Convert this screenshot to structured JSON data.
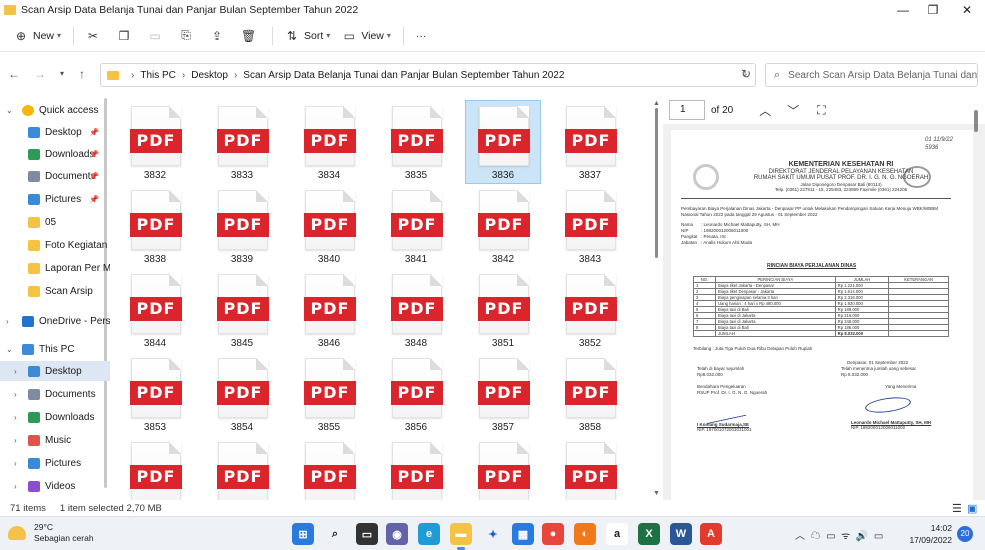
{
  "window": {
    "title": "Scan Arsip Data Belanja Tunai dan Panjar Bulan September Tahun 2022",
    "controls": [
      "—",
      "❐",
      "✕"
    ]
  },
  "commandbar": {
    "new": "New",
    "sort": "Sort",
    "view": "View",
    "more": "···"
  },
  "address": {
    "crumbs": [
      "This PC",
      "Desktop",
      "Scan Arsip Data Belanja Tunai dan Panjar Bulan September Tahun 2022"
    ],
    "search_placeholder": "Search Scan Arsip Data Belanja Tunai dan Pan..."
  },
  "nav": {
    "items": [
      {
        "label": "Quick access",
        "icon": "star-icon",
        "level": 0,
        "expanded": true
      },
      {
        "label": "Desktop",
        "icon": "desktop-icon",
        "level": 1,
        "pinned": true
      },
      {
        "label": "Downloads",
        "icon": "download-icon",
        "level": 1,
        "pinned": true
      },
      {
        "label": "Documents",
        "icon": "documents-icon",
        "level": 1,
        "pinned": true
      },
      {
        "label": "Pictures",
        "icon": "pictures-icon",
        "level": 1,
        "pinned": true
      },
      {
        "label": "05",
        "icon": "folder-icon",
        "level": 1
      },
      {
        "label": "Foto Kegiatan I",
        "icon": "folder-icon",
        "level": 1
      },
      {
        "label": "Laporan Per Mi",
        "icon": "folder-icon",
        "level": 1
      },
      {
        "label": "Scan Arsip",
        "icon": "folder-icon",
        "level": 1
      },
      {
        "label": "OneDrive - Perso",
        "icon": "cloud-icon",
        "level": 0
      },
      {
        "label": "This PC",
        "icon": "pc-icon",
        "level": 0,
        "expanded": true
      },
      {
        "label": "Desktop",
        "icon": "desktop-icon",
        "level": 1,
        "selected": true
      },
      {
        "label": "Documents",
        "icon": "documents-icon",
        "level": 1
      },
      {
        "label": "Downloads",
        "icon": "download-icon",
        "level": 1
      },
      {
        "label": "Music",
        "icon": "music-icon",
        "level": 1
      },
      {
        "label": "Pictures",
        "icon": "pictures-icon",
        "level": 1
      },
      {
        "label": "Videos",
        "icon": "videos-icon",
        "level": 1
      }
    ]
  },
  "files": {
    "badge": "PDF",
    "items": [
      "3832",
      "3833",
      "3834",
      "3835",
      "3836",
      "3837",
      "3838",
      "3839",
      "3840",
      "3841",
      "3842",
      "3843",
      "3844",
      "3845",
      "3846",
      "3848",
      "3851",
      "3852",
      "3853",
      "3854",
      "3855",
      "3856",
      "3857",
      "3858",
      "",
      "",
      "",
      "",
      "",
      ""
    ],
    "selected_index": 4
  },
  "preview": {
    "page": "1",
    "of": "of 20",
    "doc": {
      "stamp": "01 11/9/22\n5936",
      "header": [
        "KEMENTERIAN KESEHATAN RI",
        "DIREKTORAT JENDERAL PELAYANAN KESEHATAN",
        "RUMAH SAKIT UMUM PUSAT PROF. DR. I. G. N. G. NGOERAH",
        "Jalan Diponegoro Denpasar Bali (80114)",
        "Telp. (0361) 227911 - 15, 225483, 223869  Faximile (0361) 224206"
      ],
      "intro": [
        "Pembayaran Biaya Perjalanan Dinas Jakarta - Denpasar PP untuk Melakukan Pendampingan Satuan Kerja Menuju WBK/WBBM",
        "Nasional Tahun 2022 pada tanggal 29 Agustus - 01 September 2022"
      ],
      "fields": [
        [
          "Nama",
          ": Leonardo Michael Mattaputty, SH, MH"
        ],
        [
          "NIP",
          ": 198200012006011000"
        ],
        [
          "Pangkat",
          ": Penata, IIIc"
        ],
        [
          "Jabatan",
          ": Analis Hukum Ahli Muda"
        ]
      ],
      "title": "RINCIAN BIAYA PERJALANAN DINAS",
      "table_head": [
        "NO.",
        "PERINCIAN BIAYA",
        "JUMLAH",
        "KETERANGAN"
      ],
      "rows": [
        [
          "1",
          "Biaya tiket Jakarta - Denpasar",
          "Rp  1.221.000"
        ],
        [
          "2",
          "Biaya tiket Denpasar - Jakarta",
          "Rp  1.614.000"
        ],
        [
          "3",
          "Biaya penginapan selama 3 hari",
          "Rp  2.316.000"
        ],
        [
          "4",
          "Uang harian : 4 hari x Rp 480.000",
          "Rp  1.920.000"
        ],
        [
          "5",
          "Biaya taxi di Bali",
          "Rp     189.000"
        ],
        [
          "6",
          "Biaya taxi di Jakarta",
          "Rp     216.000"
        ],
        [
          "7",
          "Biaya taxi di Jakarta",
          "Rp     246.000"
        ],
        [
          "8",
          "Biaya taxi di Bali",
          "Rp     186.000"
        ]
      ],
      "total": [
        "JUMLAH",
        "Rp   8.032.000"
      ],
      "terbilang": "Terbilang : Juta Tiga Puluh Dua  Ribu Delapan Puluh  Rupiah",
      "date": "Denpasar,  01 September 2022",
      "left_sig": [
        "Telah di bayar sejumlah",
        "Rp8.032.000",
        "",
        "Bendahara Pengeluaran",
        "RSUP Prof. Dr. I. G. N. G. Ngoerah"
      ],
      "right_sig": [
        "Telah menerima jumlah uang sebesar",
        "Rp 8.032.000",
        "",
        "Yang Menerima"
      ],
      "left_name": [
        "I Komang Sudarmaja,SE",
        "NIP. 197001072003031001"
      ],
      "right_name": [
        "Leonardo Michael Mattaputty, SH, MH",
        "NIP. 198200012006011002"
      ]
    }
  },
  "status": {
    "count": "71 items",
    "selected": "1 item selected  2,70 MB"
  },
  "taskbar": {
    "temp": "29°C",
    "cond": "Sebagian cerah",
    "time": "14:02",
    "date": "17/09/2022",
    "notif": "20"
  }
}
